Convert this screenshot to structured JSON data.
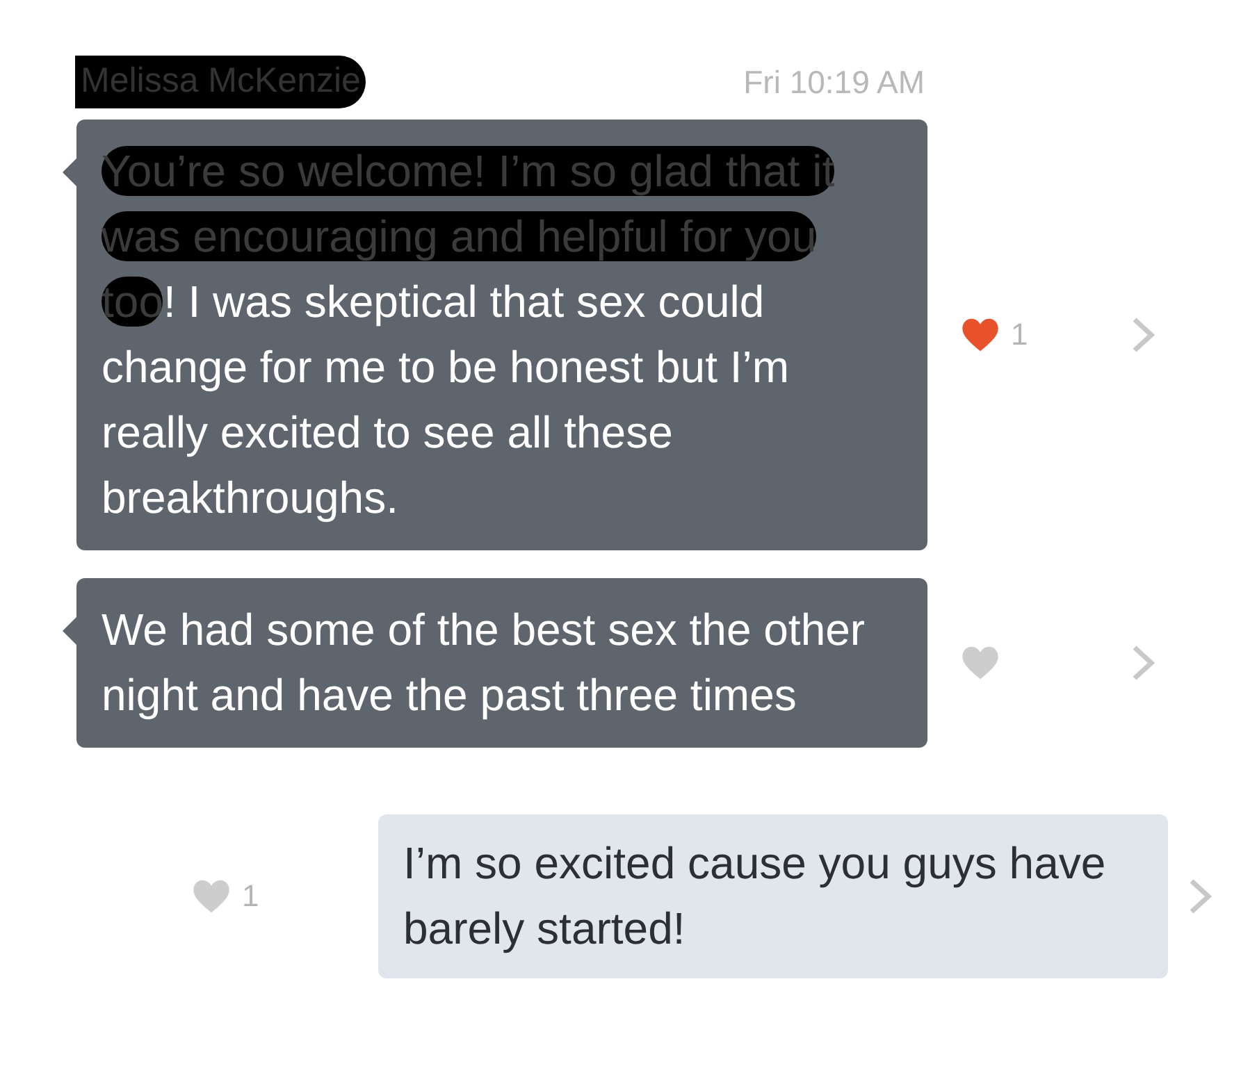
{
  "sender": {
    "name": "Melissa McKenzie",
    "redacted": true
  },
  "time": "Fri 10:19 AM",
  "messages": [
    {
      "kind": "incoming",
      "segments": [
        {
          "text": "You’re so welcome! I’m so glad that it was encouraging and helpful for you too",
          "redacted": true
        },
        {
          "text": "! I was skeptical that sex could change for me to be honest but I’m really excited to see all these breakthroughs.",
          "redacted": false
        }
      ],
      "liked": true,
      "likes": "1"
    },
    {
      "kind": "incoming",
      "segments": [
        {
          "text": "We had some of the best sex the other night and have the past three times",
          "redacted": false
        }
      ],
      "liked": false
    },
    {
      "kind": "outgoing",
      "segments": [
        {
          "text": "I’m so excited cause you guys have barely started!",
          "redacted": false
        }
      ],
      "liked": false,
      "likes": "1"
    }
  ]
}
